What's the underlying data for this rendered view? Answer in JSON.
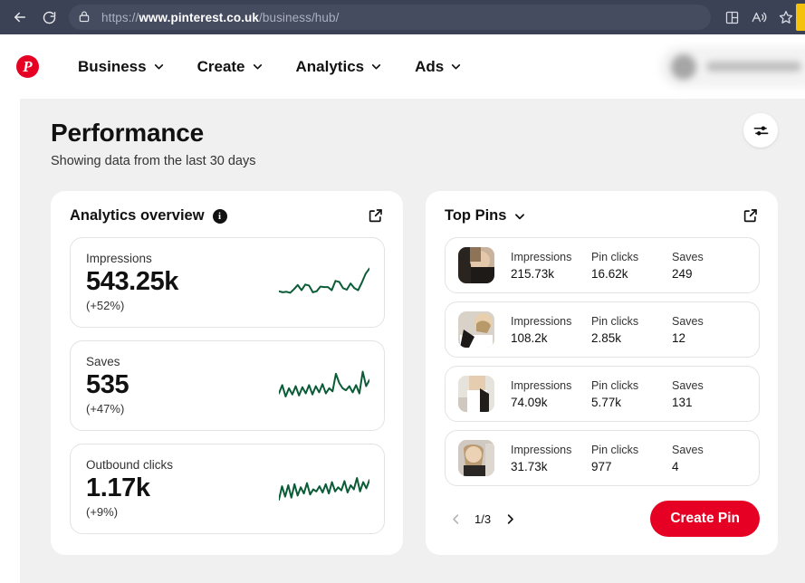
{
  "browser": {
    "url_scheme": "https://",
    "url_host": "www.pinterest.co.uk",
    "url_path": "/business/hub/",
    "back_label": "Back",
    "reload_label": "Refresh",
    "lock_icon": "lock-icon",
    "split_screen_icon": "split-screen-icon",
    "read_aloud_icon": "read-aloud-icon",
    "favorite_icon": "favorite-star-icon"
  },
  "nav": {
    "logo_letter": "P",
    "items": [
      {
        "label": "Business",
        "caret": true
      },
      {
        "label": "Create",
        "caret": true
      },
      {
        "label": "Analytics",
        "caret": true
      },
      {
        "label": "Ads",
        "caret": true
      }
    ]
  },
  "header": {
    "title": "Performance",
    "subtitle": "Showing data from the last 30 days",
    "filter_icon": "sliders-filter-icon"
  },
  "analytics_card": {
    "title": "Analytics overview",
    "info_icon": "info-icon",
    "info_glyph": "i",
    "external_link_icon": "external-link-icon",
    "metrics": [
      {
        "label": "Impressions",
        "value": "543.25k",
        "delta": "(+52%)"
      },
      {
        "label": "Saves",
        "value": "535",
        "delta": "(+47%)"
      },
      {
        "label": "Outbound clicks",
        "value": "1.17k",
        "delta": "(+9%)"
      }
    ]
  },
  "top_pins_card": {
    "title": "Top Pins",
    "chevron_icon": "chevron-down-icon",
    "external_link_icon": "external-link-icon",
    "stat_labels": {
      "impressions": "Impressions",
      "pin_clicks": "Pin clicks",
      "saves": "Saves"
    },
    "rows": [
      {
        "impressions": "215.73k",
        "pin_clicks": "16.62k",
        "saves": "249"
      },
      {
        "impressions": "108.2k",
        "pin_clicks": "2.85k",
        "saves": "12"
      },
      {
        "impressions": "74.09k",
        "pin_clicks": "5.77k",
        "saves": "131"
      },
      {
        "impressions": "31.73k",
        "pin_clicks": "977",
        "saves": "4"
      }
    ],
    "pagination": {
      "label": "1/3",
      "prev_icon": "chevron-left-icon",
      "next_icon": "chevron-right-icon"
    },
    "create_pin_label": "Create Pin"
  },
  "colors": {
    "brand_red": "#e60023",
    "sparkline_green": "#0a5c36",
    "chrome": "#3b4255",
    "page_bg": "#f0f0f0"
  },
  "chart_data": [
    {
      "type": "line",
      "title": "Impressions",
      "annotation": "543.25k (+52%)",
      "x": [
        0,
        1,
        2,
        3,
        4,
        5,
        6,
        7,
        8,
        9,
        10,
        11,
        12,
        13,
        14,
        15,
        16,
        17,
        18,
        19,
        20,
        21,
        22,
        23,
        24
      ],
      "values": [
        18,
        16,
        17,
        15,
        22,
        30,
        20,
        31,
        29,
        16,
        18,
        27,
        26,
        26,
        20,
        38,
        36,
        24,
        21,
        33,
        24,
        20,
        35,
        52,
        62
      ],
      "ylim": [
        0,
        70
      ],
      "grid": false,
      "legend": false
    },
    {
      "type": "line",
      "title": "Saves",
      "annotation": "535 (+47%)",
      "x": [
        0,
        1,
        2,
        3,
        4,
        5,
        6,
        7,
        8,
        9,
        10,
        11,
        12,
        13,
        14,
        15,
        16,
        17,
        18,
        19,
        20,
        21,
        22,
        23,
        24,
        25,
        26,
        27
      ],
      "values": [
        20,
        36,
        14,
        30,
        18,
        34,
        16,
        32,
        20,
        36,
        18,
        34,
        22,
        38,
        20,
        30,
        24,
        58,
        40,
        30,
        26,
        34,
        22,
        36,
        20,
        62,
        34,
        46
      ],
      "ylim": [
        0,
        70
      ],
      "grid": false,
      "legend": false
    },
    {
      "type": "line",
      "title": "Outbound clicks",
      "annotation": "1.17k (+9%)",
      "x": [
        0,
        1,
        2,
        3,
        4,
        5,
        6,
        7,
        8,
        9,
        10,
        11,
        12,
        13,
        14,
        15,
        16,
        17,
        18,
        19,
        20,
        21,
        22,
        23,
        24,
        25,
        26,
        27,
        28,
        29
      ],
      "values": [
        14,
        40,
        20,
        42,
        18,
        44,
        22,
        38,
        26,
        46,
        24,
        34,
        30,
        40,
        28,
        44,
        26,
        48,
        30,
        38,
        32,
        50,
        28,
        42,
        34,
        56,
        30,
        48,
        36,
        52
      ],
      "ylim": [
        0,
        70
      ],
      "grid": false,
      "legend": false
    }
  ]
}
